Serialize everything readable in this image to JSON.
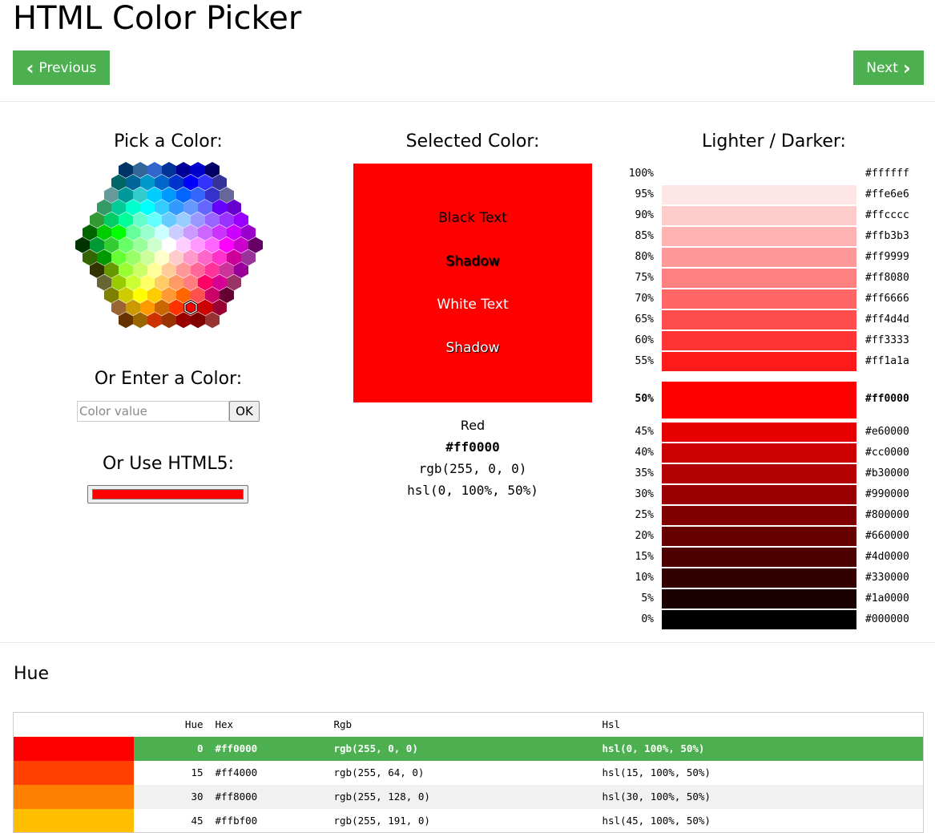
{
  "page": {
    "title": "HTML Color Picker"
  },
  "nav": {
    "previous": "Previous",
    "next": "Next",
    "prev_icon": "‹",
    "next_icon": "›"
  },
  "picker": {
    "heading": "Pick a Color:",
    "enter_heading": "Or Enter a Color:",
    "input_placeholder": "Color value",
    "input_value": "",
    "ok_label": "OK",
    "html5_heading": "Or Use HTML5:",
    "html5_value": "#ff0000",
    "selected_cell": "#ff0000"
  },
  "selected": {
    "heading": "Selected Color:",
    "color": "#ff0000",
    "black_text": "Black Text",
    "black_shadow": "Shadow",
    "white_text": "White Text",
    "white_shadow": "Shadow",
    "name": "Red",
    "hex": "#ff0000",
    "rgb": "rgb(255, 0, 0)",
    "hsl": "hsl(0, 100%, 50%)"
  },
  "shades": {
    "heading": "Lighter / Darker:",
    "items": [
      {
        "pct": "100%",
        "hex": "#ffffff"
      },
      {
        "pct": "95%",
        "hex": "#ffe6e6"
      },
      {
        "pct": "90%",
        "hex": "#ffcccc"
      },
      {
        "pct": "85%",
        "hex": "#ffb3b3"
      },
      {
        "pct": "80%",
        "hex": "#ff9999"
      },
      {
        "pct": "75%",
        "hex": "#ff8080"
      },
      {
        "pct": "70%",
        "hex": "#ff6666"
      },
      {
        "pct": "65%",
        "hex": "#ff4d4d"
      },
      {
        "pct": "60%",
        "hex": "#ff3333"
      },
      {
        "pct": "55%",
        "hex": "#ff1a1a"
      },
      {
        "pct": "50%",
        "hex": "#ff0000",
        "current": true
      },
      {
        "pct": "45%",
        "hex": "#e60000"
      },
      {
        "pct": "40%",
        "hex": "#cc0000"
      },
      {
        "pct": "35%",
        "hex": "#b30000"
      },
      {
        "pct": "30%",
        "hex": "#990000"
      },
      {
        "pct": "25%",
        "hex": "#800000"
      },
      {
        "pct": "20%",
        "hex": "#660000"
      },
      {
        "pct": "15%",
        "hex": "#4d0000"
      },
      {
        "pct": "10%",
        "hex": "#330000"
      },
      {
        "pct": "5%",
        "hex": "#1a0000"
      },
      {
        "pct": "0%",
        "hex": "#000000"
      }
    ]
  },
  "hue": {
    "heading": "Hue",
    "columns": [
      "",
      "Hue",
      "Hex",
      "Rgb",
      "Hsl"
    ],
    "rows": [
      {
        "hue": "0",
        "hex": "#ff0000",
        "rgb": "rgb(255, 0, 0)",
        "hsl": "hsl(0, 100%, 50%)",
        "selected": true
      },
      {
        "hue": "15",
        "hex": "#ff4000",
        "rgb": "rgb(255, 64, 0)",
        "hsl": "hsl(15, 100%, 50%)"
      },
      {
        "hue": "30",
        "hex": "#ff8000",
        "rgb": "rgb(255, 128, 0)",
        "hsl": "hsl(30, 100%, 50%)"
      },
      {
        "hue": "45",
        "hex": "#ffbf00",
        "rgb": "rgb(255, 191, 0)",
        "hsl": "hsl(45, 100%, 50%)"
      }
    ]
  },
  "colors": {
    "accent": "#4caf50"
  },
  "hex_map": {
    "rows": [
      [
        "#003366",
        "#336699",
        "#3366CC",
        "#003399",
        "#000099",
        "#0000CC",
        "#000066"
      ],
      [
        "#006666",
        "#006699",
        "#0099CC",
        "#0066CC",
        "#0033CC",
        "#0000FF",
        "#3333FF",
        "#333399"
      ],
      [
        "#669999",
        "#009999",
        "#33CCCC",
        "#00CCFF",
        "#0099FF",
        "#0066FF",
        "#3366FF",
        "#3333CC",
        "#666699"
      ],
      [
        "#339966",
        "#00CC99",
        "#00FFCC",
        "#00FFFF",
        "#33CCFF",
        "#3399FF",
        "#6699FF",
        "#6666FF",
        "#6600FF",
        "#6600CC"
      ],
      [
        "#339933",
        "#00CC66",
        "#00FF99",
        "#66FFCC",
        "#66FFFF",
        "#66CCFF",
        "#99CCFF",
        "#9999FF",
        "#9966FF",
        "#9933FF",
        "#9900FF"
      ],
      [
        "#006600",
        "#00CC00",
        "#00FF00",
        "#66FF99",
        "#99FFCC",
        "#CCFFFF",
        "#CCCCFF",
        "#CC99FF",
        "#CC66FF",
        "#CC33FF",
        "#CC00FF",
        "#9900CC"
      ],
      [
        "#003300",
        "#009933",
        "#33CC33",
        "#66FF66",
        "#99FF99",
        "#CCFFCC",
        "#FFFFFF",
        "#FFCCFF",
        "#FF99FF",
        "#FF66FF",
        "#FF00FF",
        "#CC00CC",
        "#660066"
      ],
      [
        "#336600",
        "#009900",
        "#66FF33",
        "#99FF66",
        "#CCFF99",
        "#FFFFCC",
        "#FFCCCC",
        "#FF99CC",
        "#FF66CC",
        "#FF33CC",
        "#CC0099",
        "#993399"
      ],
      [
        "#333300",
        "#669900",
        "#99FF33",
        "#CCFF66",
        "#FFFF99",
        "#FFCC99",
        "#FF9999",
        "#FF6699",
        "#FF3399",
        "#CC3399",
        "#990099"
      ],
      [
        "#666633",
        "#99CC00",
        "#CCFF33",
        "#FFFF66",
        "#FFCC66",
        "#FF9966",
        "#FF7C80",
        "#FF0066",
        "#D60093",
        "#993366"
      ],
      [
        "#808000",
        "#CCCC00",
        "#FFFF00",
        "#FFCC00",
        "#FF9933",
        "#FF6600",
        "#FF5050",
        "#CC0066",
        "#660033"
      ],
      [
        "#996633",
        "#CC9900",
        "#FF9900",
        "#CC6600",
        "#FF3300",
        "#FF0000",
        "#CC0000",
        "#990033"
      ],
      [
        "#663300",
        "#996600",
        "#CC3300",
        "#993300",
        "#990000",
        "#800000",
        "#993333"
      ]
    ]
  }
}
